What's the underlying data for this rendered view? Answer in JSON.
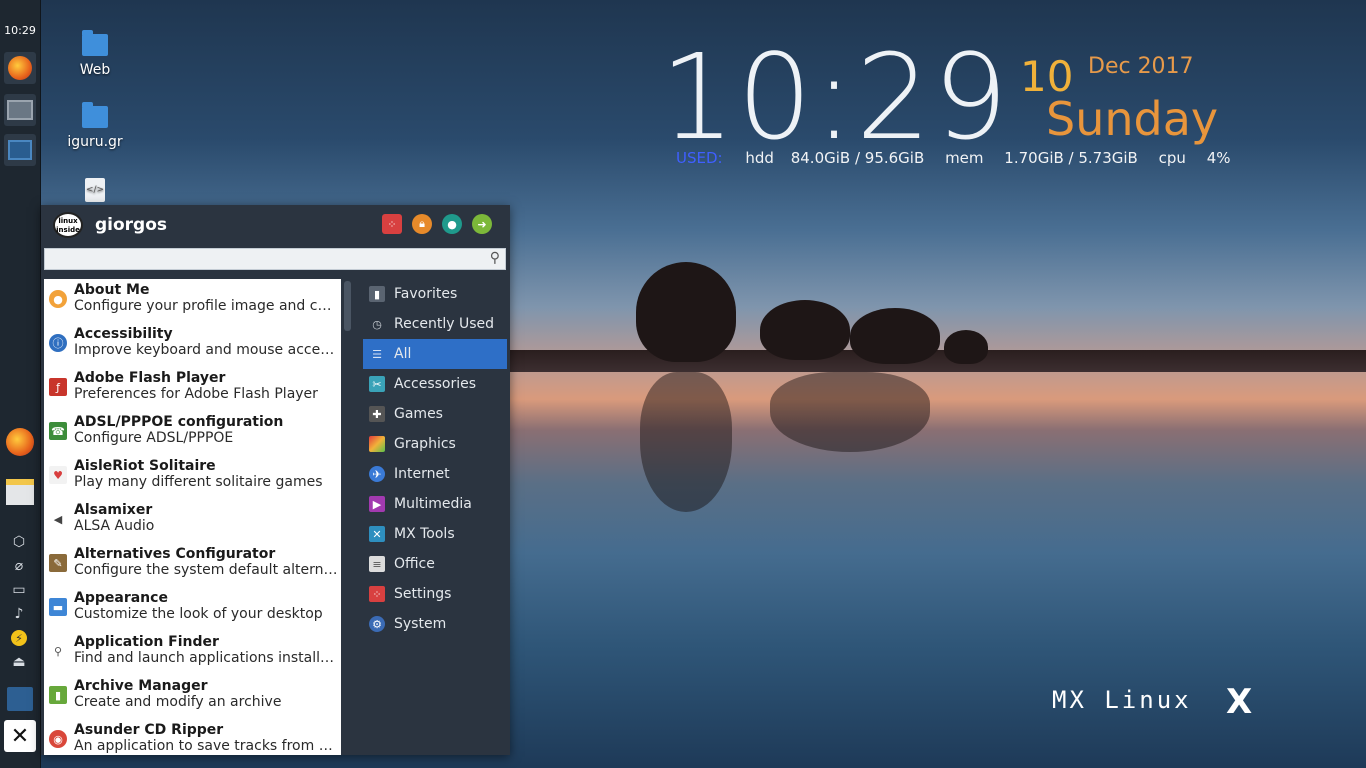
{
  "panel": {
    "clock": "10:29"
  },
  "desktop_icons": [
    {
      "label": "Web"
    },
    {
      "label": "iguru.gr"
    }
  ],
  "conky": {
    "time": "10:29",
    "day": "10",
    "month_year": "Dec 2017",
    "weekday": "Sunday",
    "used_label": "USED:",
    "hdd_label": "hdd",
    "hdd_value": "84.0GiB / 95.6GiB",
    "mem_label": "mem",
    "mem_value": "1.70GiB / 5.73GiB",
    "cpu_label": "cpu",
    "cpu_value": "4%"
  },
  "branding": {
    "text": "MX Linux",
    "logo": "X"
  },
  "menu": {
    "username": "giorgos",
    "avatar_text": "linux inside",
    "search_placeholder": "",
    "apps": [
      {
        "name": "About Me",
        "desc": "Configure your profile image and con...",
        "icon": "user-icon",
        "color": "#f2a23a"
      },
      {
        "name": "Accessibility",
        "desc": "Improve keyboard and mouse access...",
        "icon": "accessibility-icon",
        "color": "#2f6fc0"
      },
      {
        "name": "Adobe Flash Player",
        "desc": "Preferences for Adobe Flash Player",
        "icon": "flash-icon",
        "color": "#c8352b"
      },
      {
        "name": "ADSL/PPPOE configuration",
        "desc": "Configure ADSL/PPPOE",
        "icon": "phone-icon",
        "color": "#3c8d3a"
      },
      {
        "name": "AisleRiot Solitaire",
        "desc": "Play many different solitaire games",
        "icon": "cards-icon",
        "color": "#d83e3e"
      },
      {
        "name": "Alsamixer",
        "desc": "ALSA Audio",
        "icon": "speaker-icon",
        "color": "#444444"
      },
      {
        "name": "Alternatives Configurator",
        "desc": "Configure the system default alternat...",
        "icon": "tools-icon",
        "color": "#8a6a3a"
      },
      {
        "name": "Appearance",
        "desc": "Customize the look of your desktop",
        "icon": "appearance-icon",
        "color": "#3e86d6"
      },
      {
        "name": "Application Finder",
        "desc": "Find and launch applications installe...",
        "icon": "search-icon",
        "color": "#666666"
      },
      {
        "name": "Archive Manager",
        "desc": "Create and modify an archive",
        "icon": "archive-icon",
        "color": "#67a83b"
      },
      {
        "name": "Asunder CD Ripper",
        "desc": "An application to save tracks from an...",
        "icon": "cd-icon",
        "color": "#d9473a"
      }
    ],
    "categories": [
      {
        "label": "Favorites",
        "icon": "bookmark-icon",
        "color": "#3a4350"
      },
      {
        "label": "Recently Used",
        "icon": "clock-icon",
        "color": "#2b3440"
      },
      {
        "label": "All",
        "icon": "list-icon",
        "color": "#2e6fc7"
      },
      {
        "label": "Accessories",
        "icon": "accessories-icon",
        "color": "#3aa3b8"
      },
      {
        "label": "Games",
        "icon": "gamepad-icon",
        "color": "#555555"
      },
      {
        "label": "Graphics",
        "icon": "graphics-icon",
        "color": "#d86f2e"
      },
      {
        "label": "Internet",
        "icon": "globe-icon",
        "color": "#3a7ad6"
      },
      {
        "label": "Multimedia",
        "icon": "multimedia-icon",
        "color": "#a23ab0"
      },
      {
        "label": "MX Tools",
        "icon": "mx-tools-icon",
        "color": "#2e8fbf"
      },
      {
        "label": "Office",
        "icon": "document-icon",
        "color": "#dcdcdc"
      },
      {
        "label": "Settings",
        "icon": "settings-icon",
        "color": "#d84040"
      },
      {
        "label": "System",
        "icon": "gear-icon",
        "color": "#3b6bb5"
      }
    ],
    "selected_category": "All"
  }
}
